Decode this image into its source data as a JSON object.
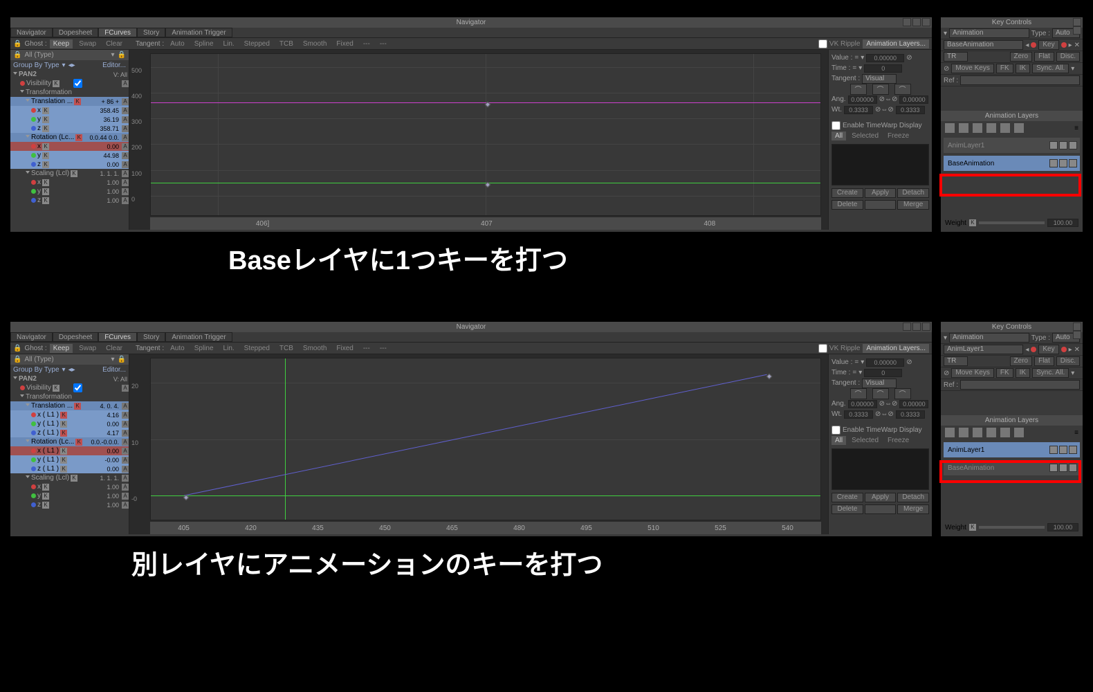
{
  "window_title": "Navigator",
  "tabs": [
    "Navigator",
    "Dopesheet",
    "FCurves",
    "Story",
    "Animation Trigger"
  ],
  "active_tab": "FCurves",
  "toolbar": {
    "ghost_label": "Ghost :",
    "ghost_opts": [
      "Keep",
      "Swap",
      "Clear"
    ],
    "tangent_label": "Tangent :",
    "tangent_opts": [
      "Auto",
      "Spline",
      "Lin.",
      "Stepped",
      "TCB",
      "Smooth",
      "Fixed",
      "---",
      "---"
    ],
    "vk_ripple": "VK Ripple",
    "anim_layers_btn": "Animation Layers..."
  },
  "tree_top": {
    "filter": "All (Type)",
    "group": "Group By Type",
    "editor": "Editor...",
    "root": "PAN2",
    "view": "V: All",
    "visibility": "Visibility",
    "transformation": "Transformation",
    "translation": "Translation ...",
    "trans_badge": "+ 86 +",
    "tx": "358.45",
    "ty": "36.19",
    "tz": "358.71",
    "rotation": "Rotation (Lc...",
    "rot_badge": "0.0.44 0.0.",
    "rx": "0.00",
    "ry": "44.98",
    "rz": "0.00",
    "scaling": "Scaling (Lcl)",
    "scale_badge": "1. 1. 1.",
    "sx": "1.00",
    "sy": "1.00",
    "sz": "1.00"
  },
  "tree_bot": {
    "translation": "Translation ...",
    "trans_badge": "4. 0. 4.",
    "tx_lbl": "x ( L1 )",
    "ty_lbl": "y ( L1 )",
    "tz_lbl": "z ( L1 )",
    "tx": "4.16",
    "ty": "0.00",
    "tz": "4.17",
    "rotation": "Rotation (Lc...",
    "rot_badge": "0.0.-0.0.0.",
    "rx_lbl": "x ( L1 )",
    "ry_lbl": "y ( L1 )",
    "rz_lbl": "z ( L1 )",
    "rx": "0.00",
    "ry": "-0.00",
    "rz": "0.00"
  },
  "graph_top": {
    "y_ticks": [
      "500",
      "400",
      "300",
      "200",
      "100",
      "0"
    ],
    "x_ticks": [
      "406]",
      "407",
      "408"
    ]
  },
  "graph_bot": {
    "y_ticks": [
      "20",
      "10",
      "-0"
    ],
    "x_ticks": [
      "405",
      "420",
      "435",
      "450",
      "465",
      "480",
      "495",
      "510",
      "525",
      "540"
    ]
  },
  "props": {
    "value": "Value :",
    "val_num": "0.00000",
    "time": "Time :",
    "time_num": "0",
    "tangent": "Tangent :",
    "tan_mode": "Visual",
    "ang": "Ang.",
    "ang1": "0.00000",
    "ang2": "0.00000",
    "wt": "Wt.",
    "wt1": "0.3333",
    "wt2": "0.3333",
    "enable_timewarp": "Enable TimeWarp Display",
    "filter_all": "All",
    "filter_sel": "Selected",
    "filter_frz": "Freeze",
    "btns": [
      "Create",
      "Apply",
      "Detach",
      "Delete",
      "",
      "Merge"
    ]
  },
  "key_controls": {
    "title": "Key Controls",
    "anim_label": "Animation",
    "type_label": "Type :",
    "type_val": "Auto",
    "layer_top": "BaseAnimation",
    "layer_bot": "AnimLayer1",
    "key": "Key",
    "tr": "TR",
    "zero": "Zero",
    "flat": "Flat",
    "disc": "Disc.",
    "move_keys": "Move Keys",
    "fk": "FK",
    "ik": "IK",
    "sync": "Sync. All.",
    "ref": "Ref :"
  },
  "anim_layers": {
    "title": "Animation Layers",
    "layer1_top": "AnimLayer1",
    "base": "BaseAnimation",
    "weight": "Weight",
    "weight_val": "100.00"
  },
  "captions": {
    "c1": "Baseレイヤに1つキーを打つ",
    "c2": "別レイヤにアニメーションのキーを打つ"
  }
}
